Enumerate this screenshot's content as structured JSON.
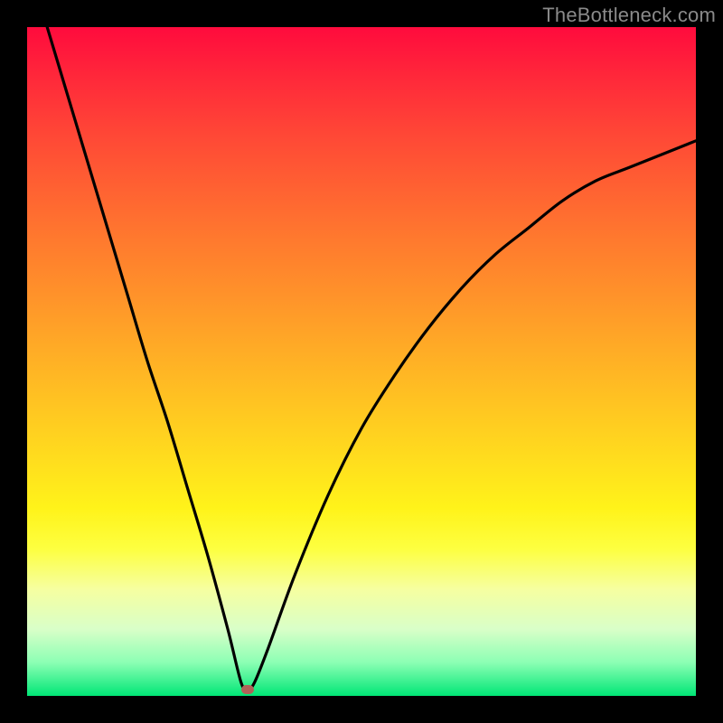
{
  "watermark": "TheBottleneck.com",
  "chart_data": {
    "type": "line",
    "title": "",
    "xlabel": "",
    "ylabel": "",
    "xlim": [
      0,
      1
    ],
    "ylim": [
      0,
      1
    ],
    "vertex_x": 0.33,
    "series": [
      {
        "name": "bottleneck-curve",
        "x": [
          0.03,
          0.06,
          0.09,
          0.12,
          0.15,
          0.18,
          0.21,
          0.24,
          0.27,
          0.3,
          0.32,
          0.33,
          0.34,
          0.36,
          0.4,
          0.45,
          0.5,
          0.55,
          0.6,
          0.65,
          0.7,
          0.75,
          0.8,
          0.85,
          0.9,
          0.95,
          1.0
        ],
        "y": [
          1.0,
          0.9,
          0.8,
          0.7,
          0.6,
          0.5,
          0.41,
          0.31,
          0.21,
          0.1,
          0.02,
          0.01,
          0.02,
          0.07,
          0.18,
          0.3,
          0.4,
          0.48,
          0.55,
          0.61,
          0.66,
          0.7,
          0.74,
          0.77,
          0.79,
          0.81,
          0.83
        ]
      }
    ],
    "marker": {
      "x": 0.33,
      "y": 0.01
    }
  },
  "colors": {
    "background": "#000000",
    "curve": "#000000",
    "marker": "#b06258",
    "gradient_top": "#ff0b3d",
    "gradient_bottom": "#00e676"
  }
}
